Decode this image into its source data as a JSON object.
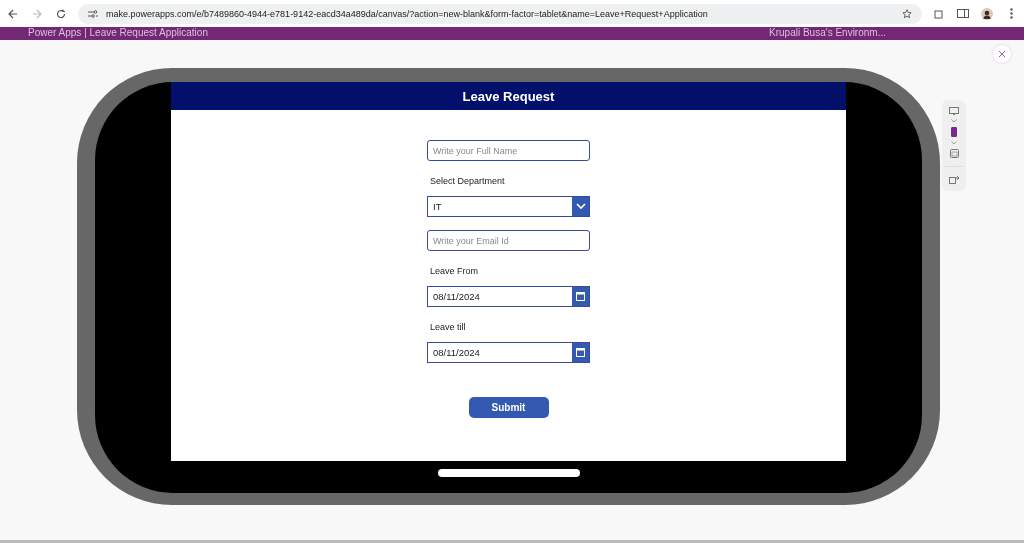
{
  "browser": {
    "url": "make.powerapps.com/e/b7489860-4944-e781-9142-eacd34a489da/canvas/?action=new-blank&form-factor=tablet&name=Leave+Request+Application"
  },
  "app_bar": {
    "title": "Power Apps  |  Leave Request Application",
    "environment": "Krupali Busa's Environm..."
  },
  "preview": {
    "devices": [
      {
        "kind": "monitor",
        "selected": false
      },
      {
        "kind": "phone",
        "selected": true
      },
      {
        "kind": "tablet",
        "selected": false
      }
    ],
    "app": {
      "header": "Leave Request",
      "fields": [
        {
          "kind": "text",
          "placeholder": "Write your Full Name"
        },
        {
          "kind": "label",
          "text": "Select Department"
        },
        {
          "kind": "dropdown",
          "value": "IT"
        },
        {
          "kind": "text",
          "placeholder": "Write your Email Id"
        },
        {
          "kind": "label",
          "text": "Leave From"
        },
        {
          "kind": "date",
          "value": "08/11/2024"
        },
        {
          "kind": "label",
          "text": "Leave till"
        },
        {
          "kind": "date",
          "value": "08/11/2024"
        }
      ],
      "submit": "Submit"
    }
  }
}
